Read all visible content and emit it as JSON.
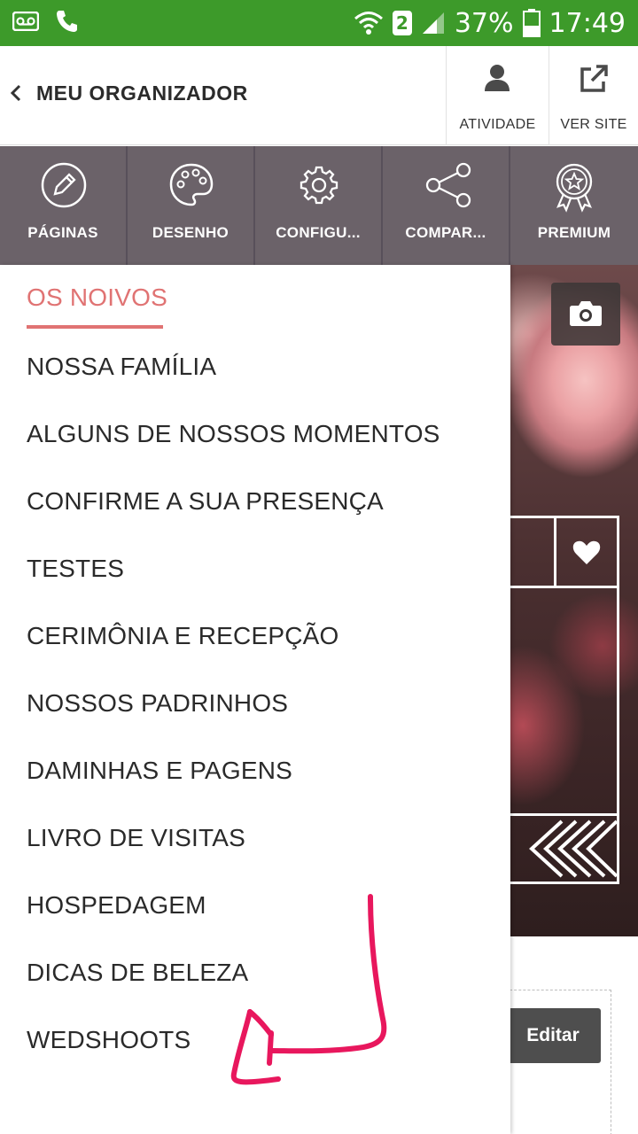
{
  "status_bar": {
    "battery": "37%",
    "time": "17:49",
    "sim": "2",
    "icons": [
      "voicemail-icon",
      "phone-icon",
      "wifi-icon",
      "signal-icon",
      "battery-icon"
    ]
  },
  "header": {
    "title": "MEU ORGANIZADOR",
    "actions": [
      {
        "label": "ATIVIDADE",
        "icon": "person-icon"
      },
      {
        "label": "VER SITE",
        "icon": "external-link-icon"
      }
    ]
  },
  "toolbar": {
    "items": [
      {
        "label": "PÁGINAS",
        "icon": "pencil-icon"
      },
      {
        "label": "DESENHO",
        "icon": "palette-icon"
      },
      {
        "label": "CONFIGU...",
        "icon": "gear-icon"
      },
      {
        "label": "COMPAR...",
        "icon": "share-icon"
      },
      {
        "label": "PREMIUM",
        "icon": "award-icon"
      }
    ]
  },
  "drawer": {
    "active": "OS NOIVOS",
    "items": [
      "NOSSA FAMÍLIA",
      "ALGUNS DE NOSSOS MOMENTOS",
      "CONFIRME A SUA PRESENÇA",
      "TESTES",
      "CERIMÔNIA E RECEPÇÃO",
      "NOSSOS PADRINHOS",
      "DAMINHAS E PAGENS",
      "LIVRO DE VISITAS",
      "HOSPEDAGEM",
      "DICAS DE BELEZA",
      "WEDSHOOTS"
    ]
  },
  "preview": {
    "edit_label": "Editar",
    "icons": [
      "camera-icon",
      "heart-icon",
      "chevron-arrows-icon"
    ]
  },
  "colors": {
    "status_bar": "#3d9a2a",
    "toolbar": "#6b6269",
    "accent": "#e07373",
    "annotation": "#e8175d"
  }
}
